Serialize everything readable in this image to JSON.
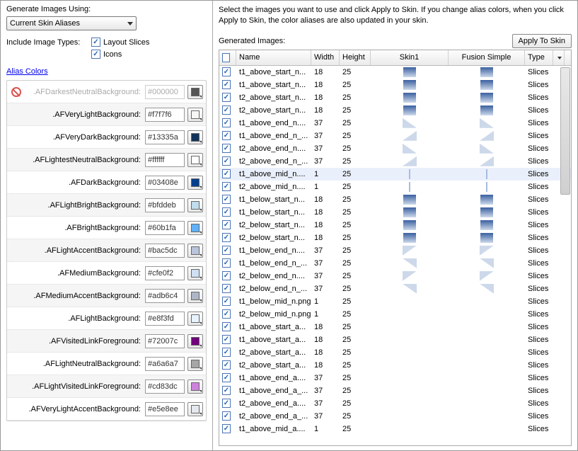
{
  "left": {
    "generateLabel": "Generate Images Using:",
    "dropdownValue": "Current Skin Aliases",
    "includeLabel": "Include Image Types:",
    "layoutSlicesLabel": "Layout Slices",
    "iconsLabel": "Icons",
    "aliasColorsLink": "Alias Colors",
    "aliases": [
      {
        "name": ".AFDarkestNeutralBackground:",
        "hex": "#000000",
        "color": "#555555",
        "disabled": true
      },
      {
        "name": ".AFVeryLightBackground:",
        "hex": "#f7f7f6",
        "color": "#f7f7f6"
      },
      {
        "name": ".AFVeryDarkBackground:",
        "hex": "#13335a",
        "color": "#13335a"
      },
      {
        "name": ".AFLightestNeutralBackground:",
        "hex": "#ffffff",
        "color": "#ffffff"
      },
      {
        "name": ".AFDarkBackground:",
        "hex": "#03408e",
        "color": "#03408e"
      },
      {
        "name": ".AFLightBrightBackground:",
        "hex": "#bfddeb",
        "color": "#bfddeb"
      },
      {
        "name": ".AFBrightBackground:",
        "hex": "#60b1fa",
        "color": "#60b1fa"
      },
      {
        "name": ".AFLightAccentBackground:",
        "hex": "#bac5dc",
        "color": "#bac5dc"
      },
      {
        "name": ".AFMediumBackground:",
        "hex": "#cfe0f2",
        "color": "#cfe0f2"
      },
      {
        "name": ".AFMediumAccentBackground:",
        "hex": "#adb6c4",
        "color": "#adb6c4"
      },
      {
        "name": ".AFLightBackground:",
        "hex": "#e8f3fd",
        "color": "#e8f3fd"
      },
      {
        "name": ".AFVisitedLinkForeground:",
        "hex": "#72007c",
        "color": "#72007c"
      },
      {
        "name": ".AFLightNeutralBackground:",
        "hex": "#a6a6a7",
        "color": "#a6a6a7"
      },
      {
        "name": ".AFLightVisitedLinkForeground:",
        "hex": "#cd83dc",
        "color": "#cd83dc"
      },
      {
        "name": ".AFVeryLightAccentBackground:",
        "hex": "#e5e8ee",
        "color": "#e5e8ee"
      }
    ]
  },
  "right": {
    "instruction": "Select the images you want to use and click Apply to Skin. If you change alias colors, when you click Apply to Skin, the color aliases are also updated in your skin.",
    "generatedLabel": "Generated Images:",
    "applyBtn": "Apply To Skin",
    "columns": [
      "",
      "Name",
      "Width",
      "Height",
      "Skin1",
      "Fusion Simple",
      "Type",
      ""
    ],
    "rows": [
      {
        "name": "t1_above_start_n...",
        "w": "18",
        "h": "25",
        "pv": "grad-v",
        "type": "Slices"
      },
      {
        "name": "t1_above_start_n...",
        "w": "18",
        "h": "25",
        "pv": "grad-v",
        "type": "Slices"
      },
      {
        "name": "t2_above_start_n...",
        "w": "18",
        "h": "25",
        "pv": "grad-v",
        "type": "Slices"
      },
      {
        "name": "t2_above_start_n...",
        "w": "18",
        "h": "25",
        "pv": "grad-v",
        "type": "Slices"
      },
      {
        "name": "t1_above_end_n....",
        "w": "37",
        "h": "25",
        "pv": "tri-left",
        "type": "Slices"
      },
      {
        "name": "t1_above_end_n_...",
        "w": "37",
        "h": "25",
        "pv": "tri-right",
        "type": "Slices"
      },
      {
        "name": "t2_above_end_n....",
        "w": "37",
        "h": "25",
        "pv": "tri-left",
        "type": "Slices"
      },
      {
        "name": "t2_above_end_n_...",
        "w": "37",
        "h": "25",
        "pv": "tri-right",
        "type": "Slices"
      },
      {
        "name": "t1_above_mid_n....",
        "w": "1",
        "h": "25",
        "pv": "line",
        "type": "Slices",
        "sel": true
      },
      {
        "name": "t2_above_mid_n....",
        "w": "1",
        "h": "25",
        "pv": "line",
        "type": "Slices"
      },
      {
        "name": "t1_below_start_n...",
        "w": "18",
        "h": "25",
        "pv": "grad-v",
        "type": "Slices"
      },
      {
        "name": "t1_below_start_n...",
        "w": "18",
        "h": "25",
        "pv": "grad-v",
        "type": "Slices"
      },
      {
        "name": "t2_below_start_n...",
        "w": "18",
        "h": "25",
        "pv": "grad-v",
        "type": "Slices"
      },
      {
        "name": "t2_below_start_n...",
        "w": "18",
        "h": "25",
        "pv": "grad-v",
        "type": "Slices"
      },
      {
        "name": "t1_below_end_n....",
        "w": "37",
        "h": "25",
        "pv": "tri-left2",
        "type": "Slices"
      },
      {
        "name": "t1_below_end_n_...",
        "w": "37",
        "h": "25",
        "pv": "tri-right2",
        "type": "Slices"
      },
      {
        "name": "t2_below_end_n....",
        "w": "37",
        "h": "25",
        "pv": "tri-left2",
        "type": "Slices"
      },
      {
        "name": "t2_below_end_n_...",
        "w": "37",
        "h": "25",
        "pv": "tri-right2",
        "type": "Slices"
      },
      {
        "name": "t1_below_mid_n.png",
        "w": "1",
        "h": "25",
        "pv": "",
        "type": "Slices"
      },
      {
        "name": "t2_below_mid_n.png",
        "w": "1",
        "h": "25",
        "pv": "",
        "type": "Slices"
      },
      {
        "name": "t1_above_start_a...",
        "w": "18",
        "h": "25",
        "pv": "",
        "type": "Slices"
      },
      {
        "name": "t1_above_start_a...",
        "w": "18",
        "h": "25",
        "pv": "",
        "type": "Slices"
      },
      {
        "name": "t2_above_start_a...",
        "w": "18",
        "h": "25",
        "pv": "",
        "type": "Slices"
      },
      {
        "name": "t2_above_start_a...",
        "w": "18",
        "h": "25",
        "pv": "",
        "type": "Slices"
      },
      {
        "name": "t1_above_end_a....",
        "w": "37",
        "h": "25",
        "pv": "",
        "type": "Slices"
      },
      {
        "name": "t1_above_end_a_...",
        "w": "37",
        "h": "25",
        "pv": "",
        "type": "Slices"
      },
      {
        "name": "t2_above_end_a....",
        "w": "37",
        "h": "25",
        "pv": "",
        "type": "Slices"
      },
      {
        "name": "t2_above_end_a_...",
        "w": "37",
        "h": "25",
        "pv": "",
        "type": "Slices"
      },
      {
        "name": "t1_above_mid_a....",
        "w": "1",
        "h": "25",
        "pv": "",
        "type": "Slices"
      }
    ]
  }
}
